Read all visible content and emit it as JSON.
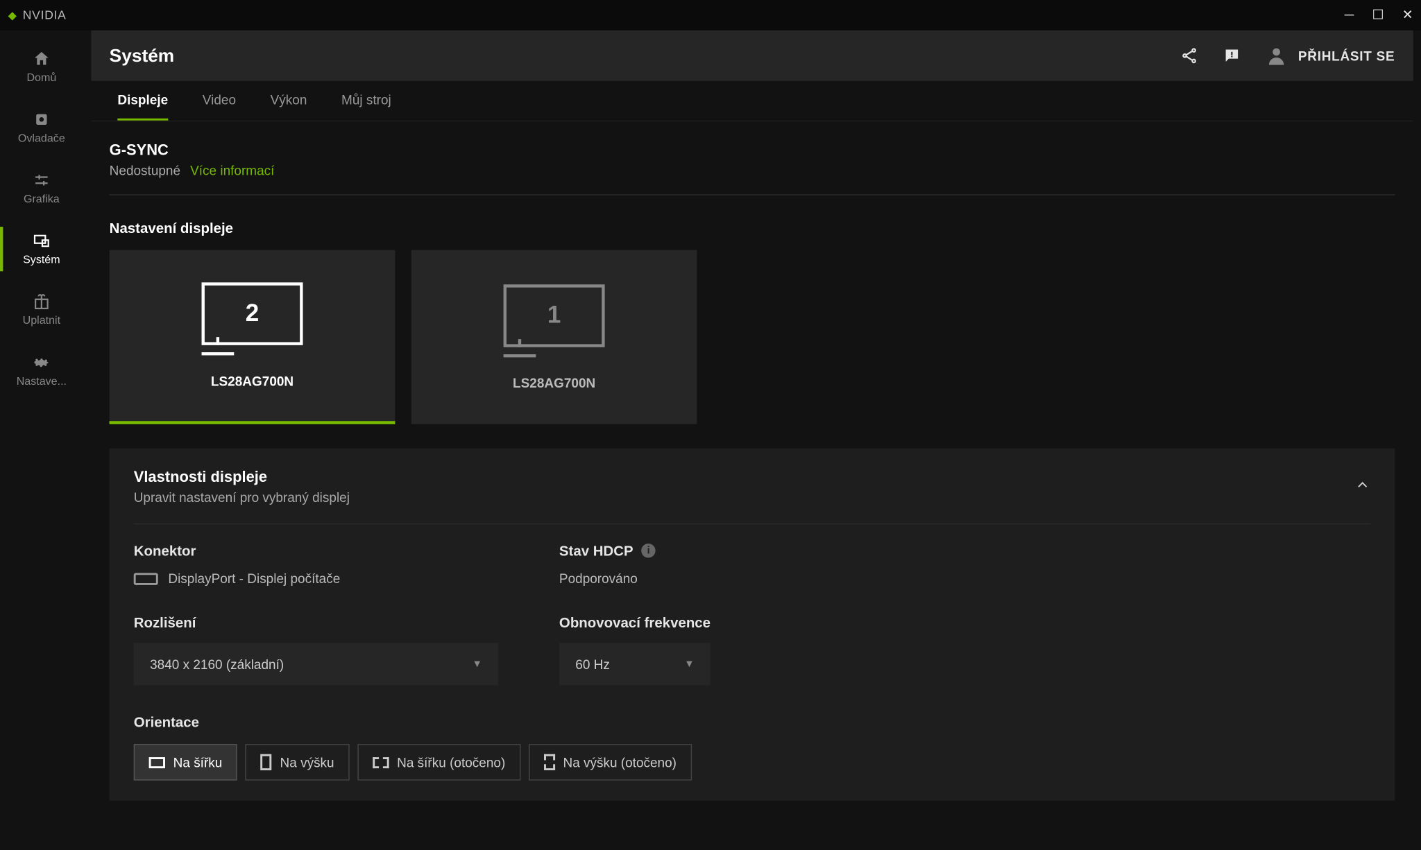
{
  "app": {
    "name": "NVIDIA"
  },
  "sidebar": {
    "items": [
      {
        "label": "Domů"
      },
      {
        "label": "Ovladače"
      },
      {
        "label": "Grafika"
      },
      {
        "label": "Systém"
      },
      {
        "label": "Uplatnit"
      },
      {
        "label": "Nastave..."
      }
    ]
  },
  "header": {
    "title": "Systém",
    "login": "PŘIHLÁSIT SE"
  },
  "tabs": [
    {
      "label": "Displeje"
    },
    {
      "label": "Video"
    },
    {
      "label": "Výkon"
    },
    {
      "label": "Můj stroj"
    }
  ],
  "gsync": {
    "title": "G-SYNC",
    "status": "Nedostupné",
    "more": "Více informací"
  },
  "display_settings": {
    "title": "Nastavení displeje"
  },
  "monitors": [
    {
      "num": "2",
      "name": "LS28AG700N"
    },
    {
      "num": "1",
      "name": "LS28AG700N"
    }
  ],
  "props": {
    "title": "Vlastnosti displeje",
    "subtitle": "Upravit nastavení pro vybraný displej",
    "connector": {
      "label": "Konektor",
      "value": "DisplayPort - Displej počítače"
    },
    "hdcp": {
      "label": "Stav HDCP",
      "value": "Podporováno"
    },
    "resolution": {
      "label": "Rozlišení",
      "value": "3840 x 2160 (základní)"
    },
    "refresh": {
      "label": "Obnovovací frekvence",
      "value": "60 Hz"
    },
    "orientation": {
      "label": "Orientace",
      "options": [
        {
          "label": "Na šířku"
        },
        {
          "label": "Na výšku"
        },
        {
          "label": "Na šířku (otočeno)"
        },
        {
          "label": "Na výšku (otočeno)"
        }
      ]
    }
  }
}
